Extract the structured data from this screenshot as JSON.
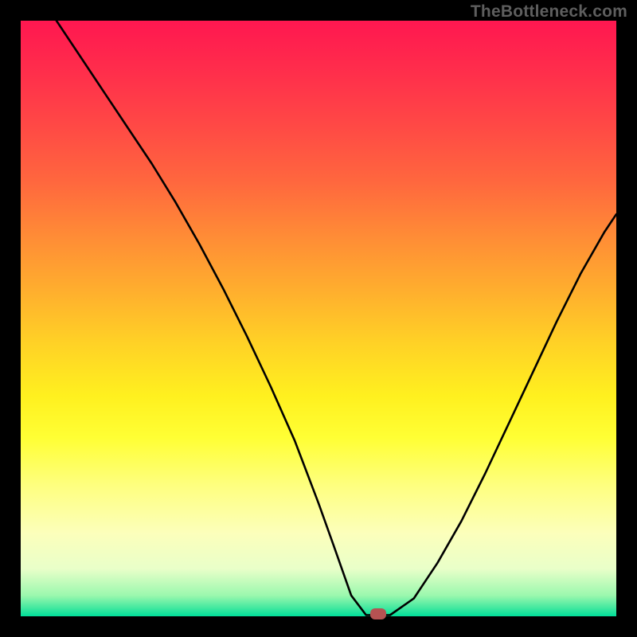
{
  "brand": "TheBottleneck.com",
  "chart_data": {
    "type": "line",
    "title": "",
    "xlabel": "",
    "ylabel": "",
    "xlim": [
      0,
      100
    ],
    "ylim": [
      0,
      100
    ],
    "grid": false,
    "series": [
      {
        "name": "bottleneck-curve",
        "x": [
          6,
          10,
          14,
          18,
          22,
          26,
          30,
          34,
          38,
          42,
          46,
          50,
          52.5,
          55.5,
          58,
          62,
          66,
          70,
          74,
          78,
          82,
          86,
          90,
          94,
          98,
          100
        ],
        "y": [
          100,
          94,
          88,
          82,
          76,
          69.5,
          62.5,
          55,
          47,
          38.5,
          29.5,
          19,
          12,
          3.5,
          0.2,
          0.2,
          3,
          9,
          16,
          24,
          32.5,
          41,
          49.5,
          57.5,
          64.5,
          67.5
        ]
      }
    ],
    "annotations": [
      {
        "name": "optimum-marker",
        "x": 60,
        "y": 0.4
      }
    ],
    "gradient_stops": [
      {
        "pos": 0,
        "hex": "#ff1750"
      },
      {
        "pos": 9,
        "hex": "#ff2f4b"
      },
      {
        "pos": 18,
        "hex": "#ff4a45"
      },
      {
        "pos": 27,
        "hex": "#ff673e"
      },
      {
        "pos": 36,
        "hex": "#ff8b36"
      },
      {
        "pos": 45,
        "hex": "#ffad2e"
      },
      {
        "pos": 54,
        "hex": "#ffd126"
      },
      {
        "pos": 63,
        "hex": "#fff01f"
      },
      {
        "pos": 70,
        "hex": "#ffff34"
      },
      {
        "pos": 78,
        "hex": "#feff7f"
      },
      {
        "pos": 86,
        "hex": "#fcffbb"
      },
      {
        "pos": 92,
        "hex": "#e9ffc9"
      },
      {
        "pos": 96.5,
        "hex": "#9bf8ae"
      },
      {
        "pos": 98.5,
        "hex": "#46e9a0"
      },
      {
        "pos": 100,
        "hex": "#00df9a"
      }
    ]
  }
}
